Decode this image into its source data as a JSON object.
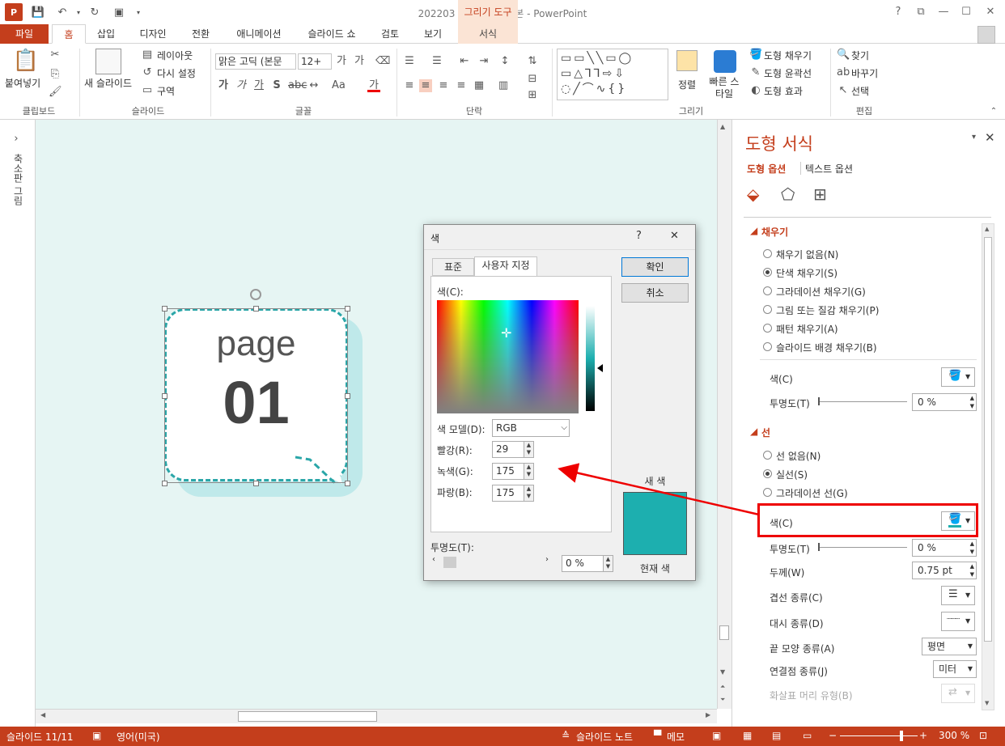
{
  "window": {
    "title": "202203 포스팅용 완성본 - PowerPoint",
    "contextual_tab": "그리기 도구",
    "controls": [
      "?",
      "⧉",
      "—",
      "☐",
      "✕"
    ]
  },
  "tabs": [
    "파일",
    "홈",
    "삽입",
    "디자인",
    "전환",
    "애니메이션",
    "슬라이드 쇼",
    "검토",
    "보기",
    "서식"
  ],
  "ribbon": {
    "clipboard": {
      "paste": "붙여넣기",
      "label": "클립보드"
    },
    "slides": {
      "new_slide": "새 슬라이드",
      "layout": "레이아웃",
      "reset": "다시 설정",
      "section": "구역",
      "label": "슬라이드"
    },
    "font": {
      "font_name": "맑은 고딕 (본문",
      "font_size": "12+",
      "label": "글꼴"
    },
    "paragraph": {
      "label": "단락"
    },
    "drawing": {
      "arrange": "정렬",
      "quick_styles": "빠른 스타일",
      "shape_fill": "도형 채우기",
      "shape_outline": "도형 윤곽선",
      "shape_effects": "도형 효과",
      "label": "그리기"
    },
    "editing": {
      "find": "찾기",
      "replace": "바꾸기",
      "select": "선택",
      "label": "편집"
    }
  },
  "thumbnail_strip": {
    "label": "축소판 그림"
  },
  "slide": {
    "bubble_word": "page",
    "bubble_number": "01",
    "background_color": "#e6f5f3",
    "bubble_outline_color": "#2aa6a8"
  },
  "dialog": {
    "title": "색",
    "help": "?",
    "close": "✕",
    "tab_standard": "표준",
    "tab_custom": "사용자 지정",
    "colors_label": "색(C):",
    "model_label": "색 모델(D):",
    "model_value": "RGB",
    "red_label": "빨강(R):",
    "red_value": "29",
    "green_label": "녹색(G):",
    "green_value": "175",
    "blue_label": "파랑(B):",
    "blue_value": "175",
    "transparency_label": "투명도(T):",
    "transparency_value": "0 %",
    "ok": "확인",
    "cancel": "취소",
    "new_label": "새 색",
    "current_label": "현재 색",
    "new_color": "#1dafaf"
  },
  "pane": {
    "title": "도형 서식",
    "tab_shape": "도형 옵션",
    "tab_text": "텍스트 옵션",
    "fill": {
      "heading": "채우기",
      "options": [
        "채우기 없음(N)",
        "단색 채우기(S)",
        "그라데이션 채우기(G)",
        "그림 또는 질감 채우기(P)",
        "패턴 채우기(A)",
        "슬라이드 배경 채우기(B)"
      ],
      "selected": 1,
      "color_label": "색(C)",
      "transparency_label": "투명도(T)",
      "transparency_value": "0 %"
    },
    "line": {
      "heading": "선",
      "options": [
        "선 없음(N)",
        "실선(S)",
        "그라데이션 선(G)"
      ],
      "selected": 1,
      "color_label": "색(C)",
      "transparency_label": "투명도(T)",
      "transparency_value": "0 %",
      "width_label": "두께(W)",
      "width_value": "0.75 pt",
      "compound_label": "겹선 종류(C)",
      "dash_label": "대시 종류(D)",
      "cap_label": "끝 모양 종류(A)",
      "cap_value": "평면",
      "join_label": "연결점 종류(J)",
      "join_value": "미터",
      "arrow_label": "화살표 머리 유형(B)",
      "line_color": "#1dafaf"
    }
  },
  "status": {
    "slide": "슬라이드 11/11",
    "language": "영어(미국)",
    "notes": "슬라이드 노트",
    "comments": "메모",
    "zoom": "300 %"
  },
  "colors": {
    "accent": "#c43e1c",
    "annotation": "#e00000"
  }
}
